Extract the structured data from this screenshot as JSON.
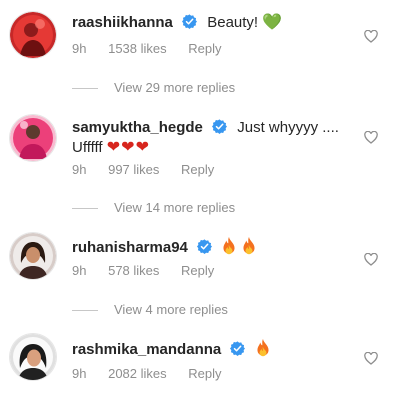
{
  "comments": [
    {
      "username": "raashiikhanna",
      "text": "Beauty!",
      "emoji": "💚",
      "time": "9h",
      "likes": "1538 likes",
      "reply": "Reply",
      "view_replies": "View 29 more replies"
    },
    {
      "username": "samyuktha_hegde",
      "text": "Just whyyyy ....",
      "text_line2": "Ufffff",
      "emoji": "❤❤❤",
      "time": "9h",
      "likes": "997 likes",
      "reply": "Reply",
      "view_replies": "View 14 more replies"
    },
    {
      "username": "ruhanisharma94",
      "text": "",
      "emoji_icons": [
        "fire-icon",
        "fire-icon"
      ],
      "time": "9h",
      "likes": "578 likes",
      "reply": "Reply",
      "view_replies": "View 4 more replies"
    },
    {
      "username": "rashmika_mandanna",
      "text": "",
      "emoji_icons": [
        "fire-icon"
      ],
      "time": "9h",
      "likes": "2082 likes",
      "reply": "Reply"
    }
  ],
  "colors": {
    "verified_badge": "#3897f0",
    "secondary_text": "#8e8e8e",
    "primary_text": "#262626"
  }
}
